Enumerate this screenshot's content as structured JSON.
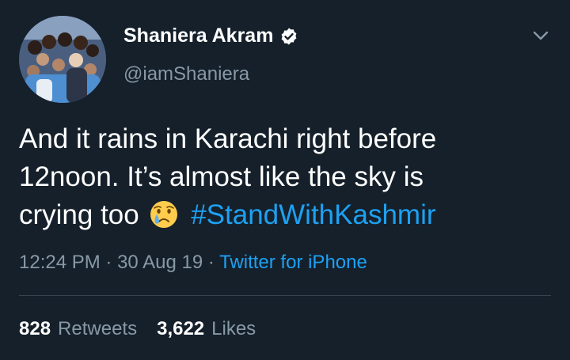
{
  "user": {
    "display_name": "Shaniera Akram",
    "handle": "@iamShaniera",
    "verified_icon": "verified-badge-icon",
    "avatar_icon": "profile-photo"
  },
  "tweet": {
    "text_line1": "And it rains in Karachi right before",
    "text_line2": "12noon. It’s almost like the sky is",
    "text_line3": "crying too",
    "emoji": "crying-face-emoji",
    "hashtag": "#StandWithKashmir",
    "time": "12:24 PM",
    "sep1": " · ",
    "date": "30 Aug 19",
    "sep2": " · ",
    "source": "Twitter for iPhone"
  },
  "stats": {
    "retweets_count": "828",
    "retweets_label": "Retweets",
    "likes_count": "3,622",
    "likes_label": "Likes"
  },
  "colors": {
    "background": "#15202b",
    "text": "#ffffff",
    "muted": "#8899a6",
    "accent": "#1da1f2",
    "divider": "#38444d"
  }
}
